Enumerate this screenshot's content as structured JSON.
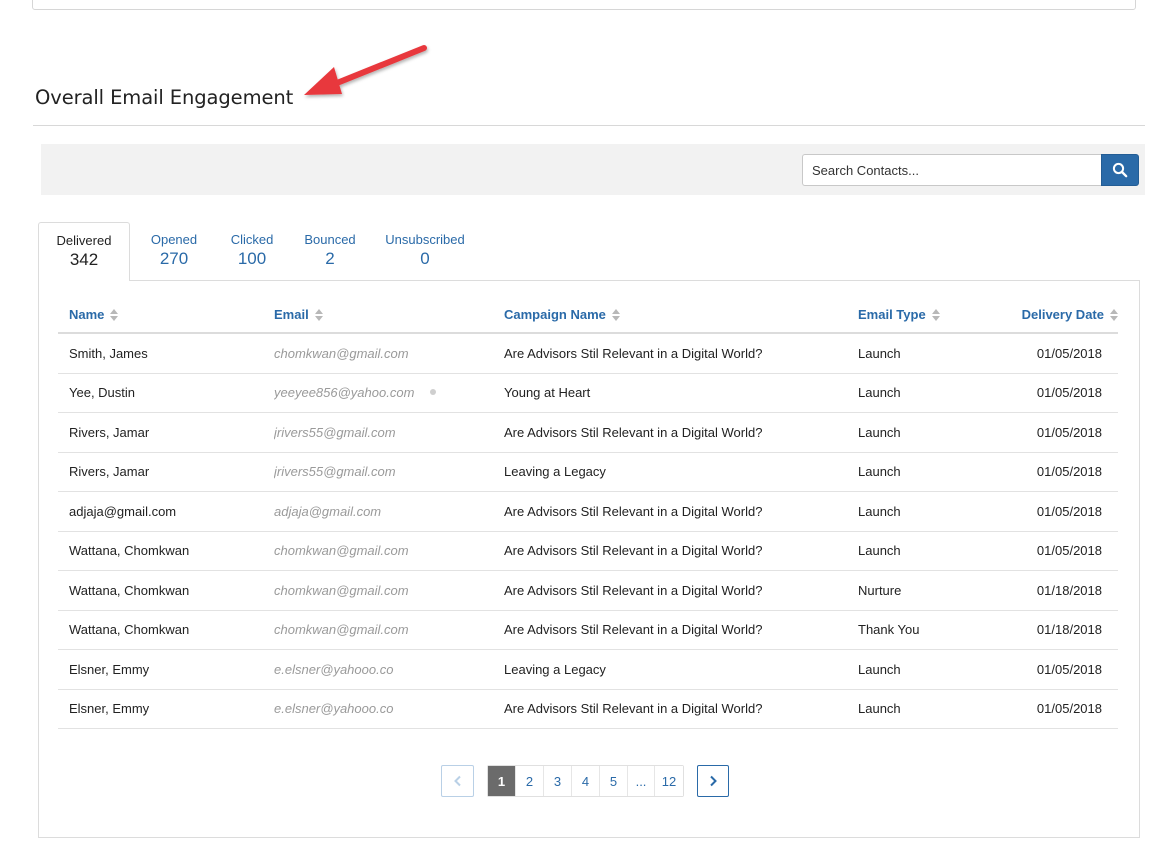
{
  "section": {
    "title": "Overall Email Engagement"
  },
  "search": {
    "placeholder": "Search Contacts..."
  },
  "tabs": [
    {
      "label": "Delivered",
      "count": "342"
    },
    {
      "label": "Opened",
      "count": "270"
    },
    {
      "label": "Clicked",
      "count": "100"
    },
    {
      "label": "Bounced",
      "count": "2"
    },
    {
      "label": "Unsubscribed",
      "count": "0"
    }
  ],
  "table": {
    "columns": [
      "Name",
      "Email",
      "Campaign Name",
      "Email Type",
      "Delivery Date"
    ],
    "rows": [
      [
        "Smith, James",
        "chomkwan@gmail.com",
        "Are Advisors Stil Relevant in a Digital World?",
        "Launch",
        "01/05/2018"
      ],
      [
        "Yee, Dustin",
        "yeeyee856@yahoo.com",
        "Young at Heart",
        "Launch",
        "01/05/2018"
      ],
      [
        "Rivers, Jamar",
        "jrivers55@gmail.com",
        "Are Advisors Stil Relevant in a Digital World?",
        "Launch",
        "01/05/2018"
      ],
      [
        "Rivers, Jamar",
        "jrivers55@gmail.com",
        "Leaving a Legacy",
        "Launch",
        "01/05/2018"
      ],
      [
        "adjaja@gmail.com",
        "adjaja@gmail.com",
        "Are Advisors Stil Relevant in a Digital World?",
        "Launch",
        "01/05/2018"
      ],
      [
        "Wattana, Chomkwan",
        "chomkwan@gmail.com",
        "Are Advisors Stil Relevant in a Digital World?",
        "Launch",
        "01/05/2018"
      ],
      [
        "Wattana, Chomkwan",
        "chomkwan@gmail.com",
        "Are Advisors Stil Relevant in a Digital World?",
        "Nurture",
        "01/18/2018"
      ],
      [
        "Wattana, Chomkwan",
        "chomkwan@gmail.com",
        "Are Advisors Stil Relevant in a Digital World?",
        "Thank You",
        "01/18/2018"
      ],
      [
        "Elsner, Emmy",
        "e.elsner@yahooo.co",
        "Leaving a Legacy",
        "Launch",
        "01/05/2018"
      ],
      [
        "Elsner, Emmy",
        "e.elsner@yahooo.co",
        "Are Advisors Stil Relevant in a Digital World?",
        "Launch",
        "01/05/2018"
      ]
    ]
  },
  "pagination": {
    "pages": [
      "1",
      "2",
      "3",
      "4",
      "5",
      "...",
      "12"
    ],
    "current": "1"
  },
  "colors": {
    "accent": "#2a6aa8",
    "annotation_arrow": "#e8383d",
    "active_page": "#6b6b6b"
  },
  "icons": {
    "search": "search-icon",
    "sort": "sort-icon",
    "prev": "chevron-left-icon",
    "next": "chevron-right-icon",
    "annotation": "arrow-annotation-icon"
  }
}
